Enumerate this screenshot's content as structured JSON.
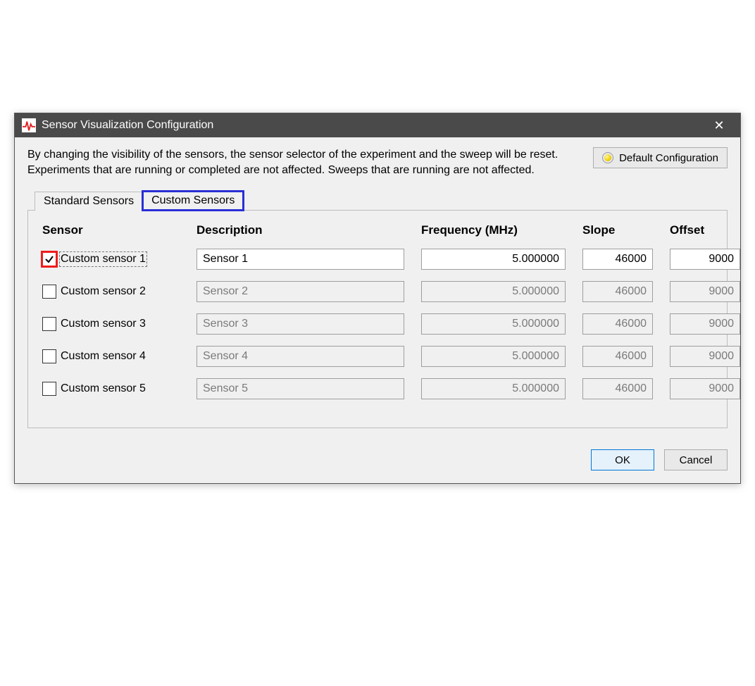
{
  "window": {
    "title": "Sensor Visualization Configuration",
    "info_text": "By changing the visibility of the sensors, the sensor selector of the experiment and the sweep will be reset. Experiments that are running or completed are not affected. Sweeps that are running are not affected.",
    "default_button": "Default Configuration"
  },
  "tabs": {
    "standard": "Standard Sensors",
    "custom": "Custom Sensors"
  },
  "columns": {
    "sensor": "Sensor",
    "description": "Description",
    "frequency": "Frequency (MHz)",
    "slope": "Slope",
    "offset": "Offset"
  },
  "rows": [
    {
      "label": "Custom sensor 1",
      "checked": true,
      "highlight": true,
      "desc": "Sensor 1",
      "freq": "5.000000",
      "slope": "46000",
      "offset": "9000"
    },
    {
      "label": "Custom sensor 2",
      "checked": false,
      "highlight": false,
      "desc": "Sensor 2",
      "freq": "5.000000",
      "slope": "46000",
      "offset": "9000"
    },
    {
      "label": "Custom sensor 3",
      "checked": false,
      "highlight": false,
      "desc": "Sensor 3",
      "freq": "5.000000",
      "slope": "46000",
      "offset": "9000"
    },
    {
      "label": "Custom sensor 4",
      "checked": false,
      "highlight": false,
      "desc": "Sensor 4",
      "freq": "5.000000",
      "slope": "46000",
      "offset": "9000"
    },
    {
      "label": "Custom sensor 5",
      "checked": false,
      "highlight": false,
      "desc": "Sensor 5",
      "freq": "5.000000",
      "slope": "46000",
      "offset": "9000"
    }
  ],
  "footer": {
    "ok": "OK",
    "cancel": "Cancel"
  }
}
